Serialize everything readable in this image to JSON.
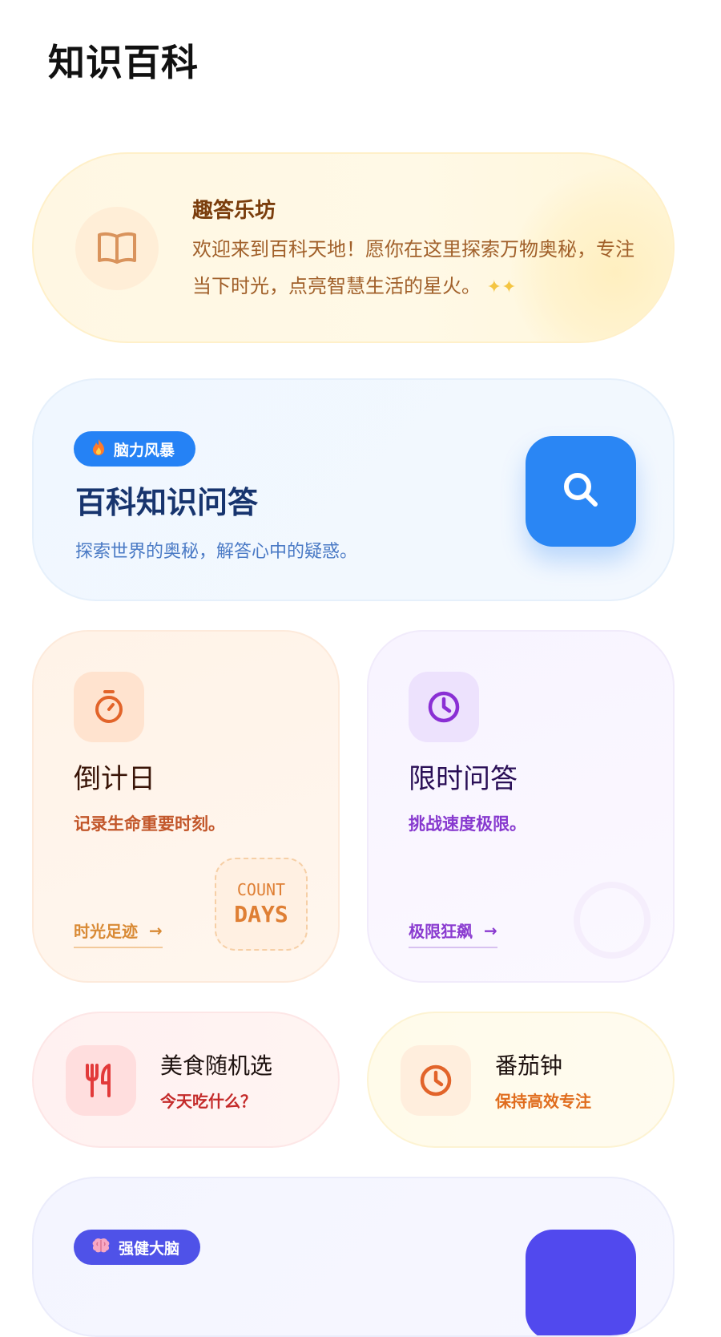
{
  "page": {
    "title": "知识百科"
  },
  "welcome": {
    "title": "趣答乐坊",
    "text": "欢迎来到百科天地！愿你在这里探索万物奥秘，专注当下时光，点亮智慧生活的星火。",
    "icon": "book-icon"
  },
  "quiz": {
    "badge": "脑力风暴",
    "badge_icon": "fire-icon",
    "title": "百科知识问答",
    "subtitle": "探索世界的奥秘，解答心中的疑惑。",
    "button_icon": "search-icon",
    "accent": "#2a86f4"
  },
  "countdown": {
    "title": "倒计日",
    "desc": "记录生命重要时刻。",
    "link": "时光足迹",
    "arrow": "→",
    "stamp_top": "COUNT",
    "stamp_bottom": "DAYS",
    "icon": "stopwatch-icon"
  },
  "timed": {
    "title": "限时问答",
    "desc": "挑战速度极限。",
    "link": "极限狂飙",
    "arrow": "→",
    "icon": "clock-icon"
  },
  "food": {
    "title": "美食随机选",
    "subtitle": "今天吃什么？",
    "icon": "utensils-icon"
  },
  "pomodoro": {
    "title": "番茄钟",
    "subtitle": "保持高效专注",
    "icon": "clock-icon"
  },
  "brain": {
    "badge": "强健大脑",
    "badge_icon": "brain-icon",
    "accent": "#5149ee"
  }
}
